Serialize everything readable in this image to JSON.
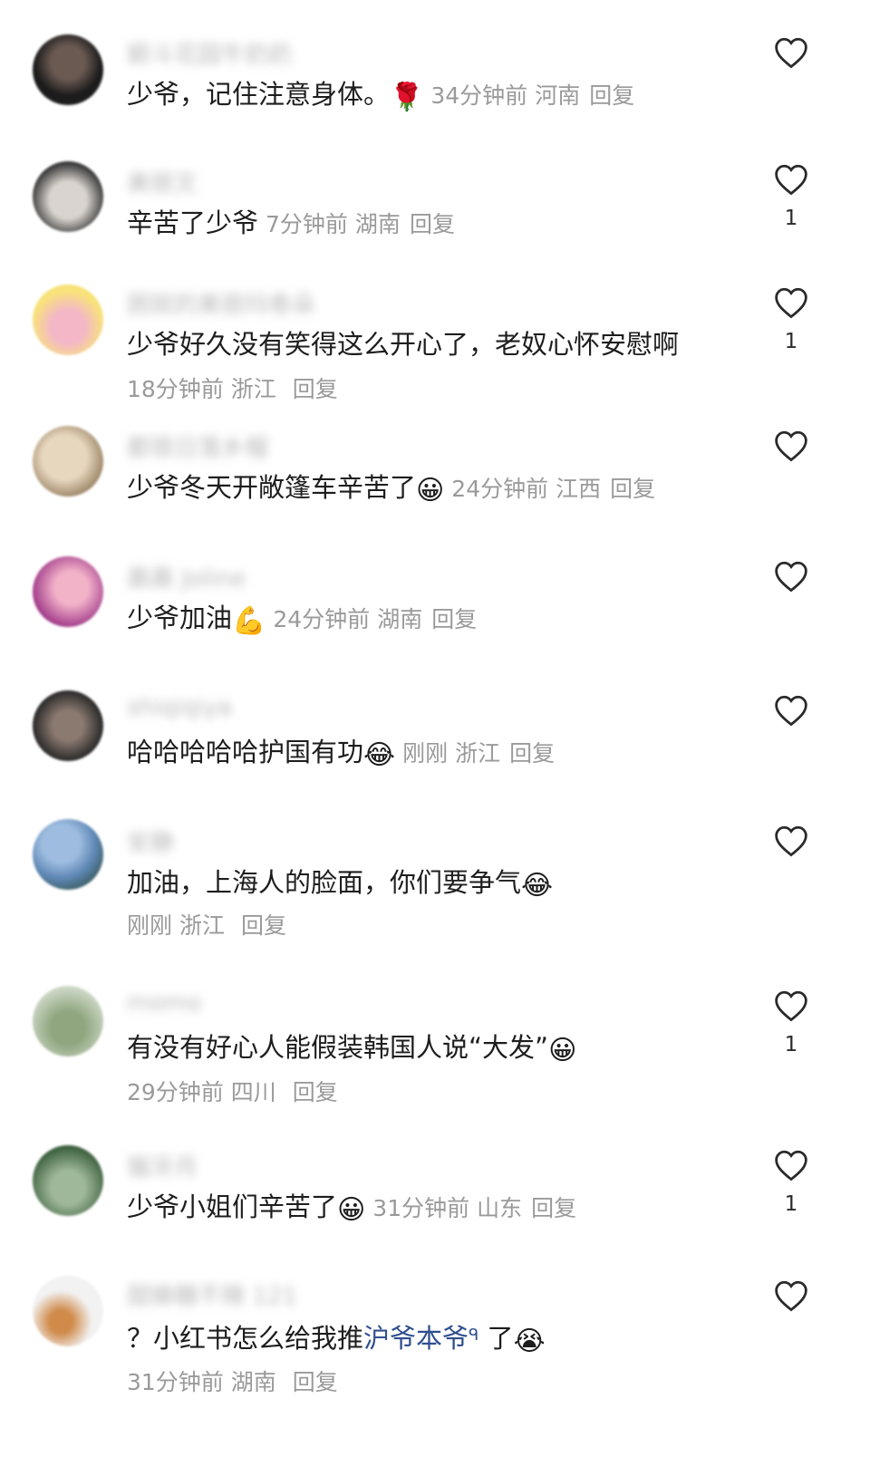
{
  "comments": [
    {
      "username": "颖斗花园牛奶奶",
      "text": "少爷，记住注意身体。",
      "emoji": "🌹",
      "time": "34分钟前",
      "location": "河南",
      "reply": "回复",
      "likes": "",
      "avatar_colors": [
        "#1c1c1c",
        "#6b5a52"
      ]
    },
    {
      "username": "美丽文",
      "text": "辛苦了少爷",
      "emoji": "",
      "time": "7分钟前",
      "location": "湖南",
      "reply": "回复",
      "likes": "1",
      "avatar_colors": [
        "#d9d4cf",
        "#3c3c3c"
      ]
    },
    {
      "username": "困就的美丽玛卷朵",
      "text": "少爷好久没有笑得这么开心了，老奴心怀安慰啊",
      "emoji": "",
      "time": "18分钟前",
      "location": "浙江",
      "reply": "回复",
      "likes": "1",
      "avatar_colors": [
        "#f8e27a",
        "#f3b7c8"
      ]
    },
    {
      "username": "都很日落乡榴",
      "text": "少爷冬天开敞篷车辛苦了",
      "emoji": "😀",
      "time": "24分钟前",
      "location": "江西",
      "reply": "回复",
      "likes": "",
      "avatar_colors": [
        "#e7d7bf",
        "#8f7656"
      ]
    },
    {
      "username": "晨晨 Joline",
      "text": "少爷加油",
      "emoji": "💪",
      "time": "24分钟前",
      "location": "湖南",
      "reply": "回复",
      "likes": "",
      "avatar_colors": [
        "#a5408d",
        "#f2b2c8"
      ]
    },
    {
      "username": "shiqiqiya",
      "text": "哈哈哈哈哈护国有功",
      "emoji": "😂",
      "time": "刚刚",
      "location": "浙江",
      "reply": "回复",
      "likes": "",
      "avatar_colors": [
        "#2a2a2a",
        "#8b7a70"
      ]
    },
    {
      "username": "安静",
      "text": "加油，上海人的脸面，你们要争气",
      "emoji": "😂",
      "time": "刚刚",
      "location": "浙江",
      "reply": "回复",
      "likes": "",
      "avatar_colors": [
        "#5f88b6",
        "#2c4b3a"
      ]
    },
    {
      "username": "momo",
      "text": "有没有好心人能假装韩国人说“大发”",
      "emoji": "😀",
      "time": "29分钟前",
      "location": "四川",
      "reply": "回复",
      "likes": "1",
      "avatar_colors": [
        "#cfd9c9",
        "#8fa67f"
      ]
    },
    {
      "username": "猫牙月",
      "text": "少爷小姐们辛苦了",
      "emoji": "😀",
      "time": "31分钟前",
      "location": "山东",
      "reply": "回复",
      "likes": "1",
      "avatar_colors": [
        "#3a5e3c",
        "#9fb89a"
      ]
    },
    {
      "username": "甜蜂糖不辣 121",
      "text_prefix": "？小红书怎么给我推",
      "link": "沪爷本爷",
      "link_icon": "ᑫ",
      "text_suffix": " 了",
      "emoji": "😭",
      "time": "31分钟前",
      "location": "湖南",
      "reply": "回复",
      "likes": "",
      "avatar_colors": [
        "#f2f2f2",
        "#d08a4a"
      ]
    }
  ]
}
